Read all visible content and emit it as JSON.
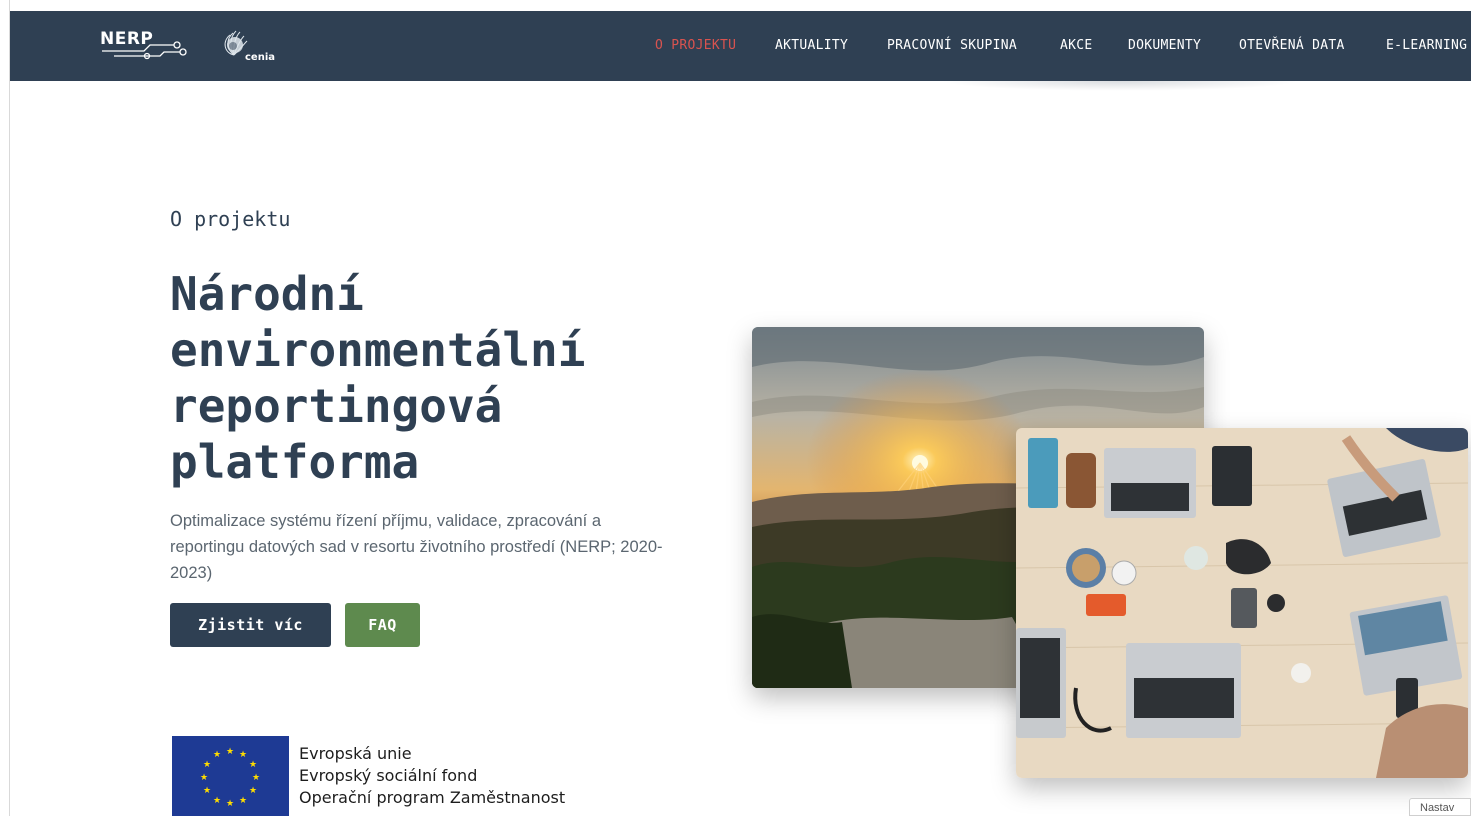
{
  "header": {
    "logo_nerp": "NERP",
    "logo_cenia": "cenia",
    "nav": [
      {
        "label": "O PROJEKTU",
        "active": true
      },
      {
        "label": "AKTUALITY",
        "active": false
      },
      {
        "label": "PRACOVNÍ SKUPINA",
        "active": false
      },
      {
        "label": "AKCE",
        "active": false
      },
      {
        "label": "DOKUMENTY",
        "active": false
      },
      {
        "label": "OTEVŘENÁ DATA",
        "active": false
      },
      {
        "label": "E-LEARNING",
        "active": false
      }
    ]
  },
  "hero": {
    "eyebrow": "O projektu",
    "title": "Národní environmentální reportingová platforma",
    "description": "Optimalizace systému řízení příjmu, validace, zpracování a reportingu datových sad v resortu životního prostředí (NERP; 2020-2023)",
    "button_more": "Zjistit víc",
    "button_faq": "FAQ"
  },
  "eu": {
    "line1": "Evropská unie",
    "line2": "Evropský sociální fond",
    "line3": "Operační program Zaměstnanost"
  },
  "corner_widget": "Nastav",
  "colors": {
    "header_bg": "#2f4053",
    "active_nav": "#d9534f",
    "button_dark": "#2f4053",
    "button_green": "#5e8a4e",
    "eu_blue": "#1e3a94",
    "eu_star": "#ffdd00"
  }
}
